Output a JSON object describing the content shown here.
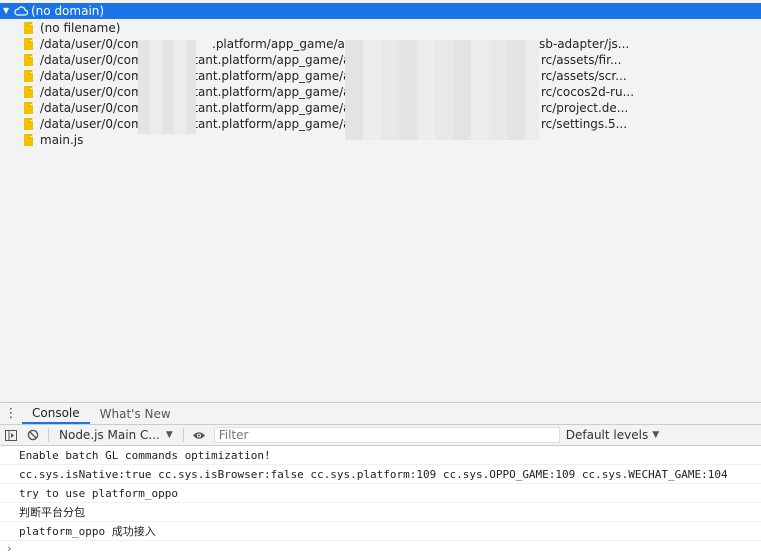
{
  "sources": {
    "domain": "(no domain)",
    "files": [
      "(no filename)",
      "/data/user/0/com",
      "/data/user/0/com",
      "/data/user/0/com",
      "/data/user/0/com",
      "/data/user/0/com",
      "/data/user/0/com.",
      "main.js"
    ],
    "mid": [
      "",
      ".platform/app_game/app",
      "stant.platform/app_game/app",
      "stant.platform/app_game/app",
      "stant.platform/app_game/app",
      "stant.platform/app_game/apr",
      "stant.platform/app_game/ap",
      ""
    ],
    "tail": [
      "",
      "sb-adapter/js...",
      "rc/assets/fir...",
      "rc/assets/scr...",
      "rc/cocos2d-ru...",
      "rc/project.de...",
      "rc/settings.5...",
      ""
    ]
  },
  "drawer": {
    "tabs": [
      "Console",
      "What's New"
    ]
  },
  "toolbar": {
    "context": "Node.js Main C...",
    "filter_placeholder": "Filter",
    "levels": "Default levels"
  },
  "console": {
    "messages": [
      "Enable batch GL commands optimization!",
      "cc.sys.isNative:true cc.sys.isBrowser:false cc.sys.platform:109 cc.sys.OPPO_GAME:109 cc.sys.WECHAT_GAME:104",
      "try to use platform_oppo",
      "判断平台分包",
      "platform_oppo 成功接入"
    ],
    "prompt": "›"
  },
  "colors": {
    "accent": "#1a73e8",
    "folder": "#f2c100"
  }
}
